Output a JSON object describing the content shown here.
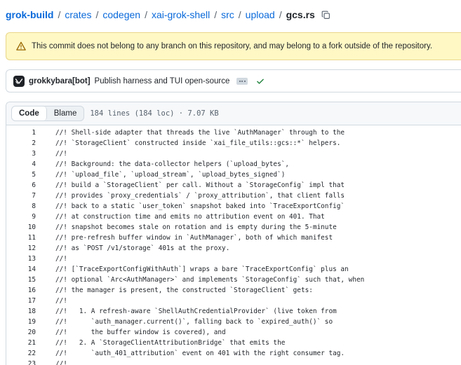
{
  "breadcrumb": {
    "items": [
      "grok-build",
      "crates",
      "codegen",
      "xai-grok-shell",
      "src",
      "upload"
    ],
    "file": "gcs.rs",
    "separator": "/"
  },
  "warning": {
    "text": "This commit does not belong to any branch on this repository, and may belong to a fork outside of the repository."
  },
  "commit": {
    "author": "grokkybara[bot]",
    "message": "Publish harness and TUI open-source"
  },
  "file_header": {
    "tabs": [
      "Code",
      "Blame"
    ],
    "meta": "184 lines (184 loc) · 7.07 KB"
  },
  "code": {
    "lines": [
      {
        "n": "1",
        "t": "//! Shell-side adapter that threads the live `AuthManager` through to the"
      },
      {
        "n": "2",
        "t": "//! `StorageClient` constructed inside `xai_file_utils::gcs::*` helpers."
      },
      {
        "n": "3",
        "t": "//!"
      },
      {
        "n": "4",
        "t": "//! Background: the data-collector helpers (`upload_bytes`,"
      },
      {
        "n": "5",
        "t": "//! `upload_file`, `upload_stream`, `upload_bytes_signed`)"
      },
      {
        "n": "6",
        "t": "//! build a `StorageClient` per call. Without a `StorageConfig` impl that"
      },
      {
        "n": "7",
        "t": "//! provides `proxy_credentials` / `proxy_attribution`, that client falls"
      },
      {
        "n": "8",
        "t": "//! back to a static `user_token` snapshot baked into `TraceExportConfig`"
      },
      {
        "n": "9",
        "t": "//! at construction time and emits no attribution event on 401. That"
      },
      {
        "n": "10",
        "t": "//! snapshot becomes stale on rotation and is empty during the 5-minute"
      },
      {
        "n": "11",
        "t": "//! pre-refresh buffer window in `AuthManager`, both of which manifest"
      },
      {
        "n": "12",
        "t": "//! as `POST /v1/storage` 401s at the proxy."
      },
      {
        "n": "13",
        "t": "//!"
      },
      {
        "n": "14",
        "t": "//! [`TraceExportConfigWithAuth`] wraps a bare `TraceExportConfig` plus an"
      },
      {
        "n": "15",
        "t": "//! optional `Arc<AuthManager>` and implements `StorageConfig` such that, when"
      },
      {
        "n": "16",
        "t": "//! the manager is present, the constructed `StorageClient` gets:"
      },
      {
        "n": "17",
        "t": "//!"
      },
      {
        "n": "18",
        "t": "//!   1. A refresh-aware `ShellAuthCredentialProvider` (live token from"
      },
      {
        "n": "19",
        "t": "//!      `auth_manager.current()`, falling back to `expired_auth()` so"
      },
      {
        "n": "20",
        "t": "//!      the buffer window is covered), and"
      },
      {
        "n": "21",
        "t": "//!   2. A `StorageClientAttributionBridge` that emits the"
      },
      {
        "n": "22",
        "t": "//!      `auth_401_attribution` event on 401 with the right consumer tag."
      },
      {
        "n": "23",
        "t": "//!"
      }
    ]
  },
  "colors": {
    "link": "#0969da",
    "warning_bg": "#fff8c5",
    "warning_icon": "#9a6700",
    "success": "#1a7f37",
    "border": "#d1d9e0"
  }
}
